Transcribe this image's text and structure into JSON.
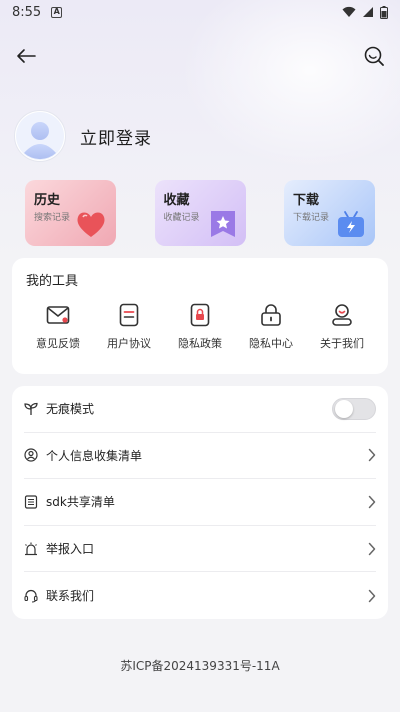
{
  "status_bar": {
    "time": "8:55",
    "badge": "A"
  },
  "profile": {
    "login_label": "立即登录"
  },
  "quick_cards": [
    {
      "title": "历史",
      "subtitle": "搜索记录",
      "icon": "heart-icon",
      "color": "#f0a8b3"
    },
    {
      "title": "收藏",
      "subtitle": "收藏记录",
      "icon": "star-bookmark-icon",
      "color": "#d3bff6"
    },
    {
      "title": "下载",
      "subtitle": "下载记录",
      "icon": "tv-download-icon",
      "color": "#a9c6f8"
    }
  ],
  "tools": {
    "title": "我的工具",
    "items": [
      {
        "label": "意见反馈",
        "icon": "mail-icon"
      },
      {
        "label": "用户协议",
        "icon": "document-icon"
      },
      {
        "label": "隐私政策",
        "icon": "lock-document-icon"
      },
      {
        "label": "隐私中心",
        "icon": "lock-icon"
      },
      {
        "label": "关于我们",
        "icon": "person-icon"
      }
    ]
  },
  "settings": [
    {
      "label": "无痕模式",
      "icon": "sprout-icon",
      "control": "toggle",
      "toggle_on": false
    },
    {
      "label": "个人信息收集清单",
      "icon": "user-circle-icon",
      "control": "chevron"
    },
    {
      "label": "sdk共享清单",
      "icon": "list-icon",
      "control": "chevron"
    },
    {
      "label": "举报入口",
      "icon": "alarm-icon",
      "control": "chevron"
    },
    {
      "label": "联系我们",
      "icon": "headset-icon",
      "control": "chevron"
    }
  ],
  "footer": {
    "icp": "苏ICP备2024139331号-11A"
  },
  "colors": {
    "accent_red": "#e8484e",
    "background": "#f3f3f6"
  }
}
